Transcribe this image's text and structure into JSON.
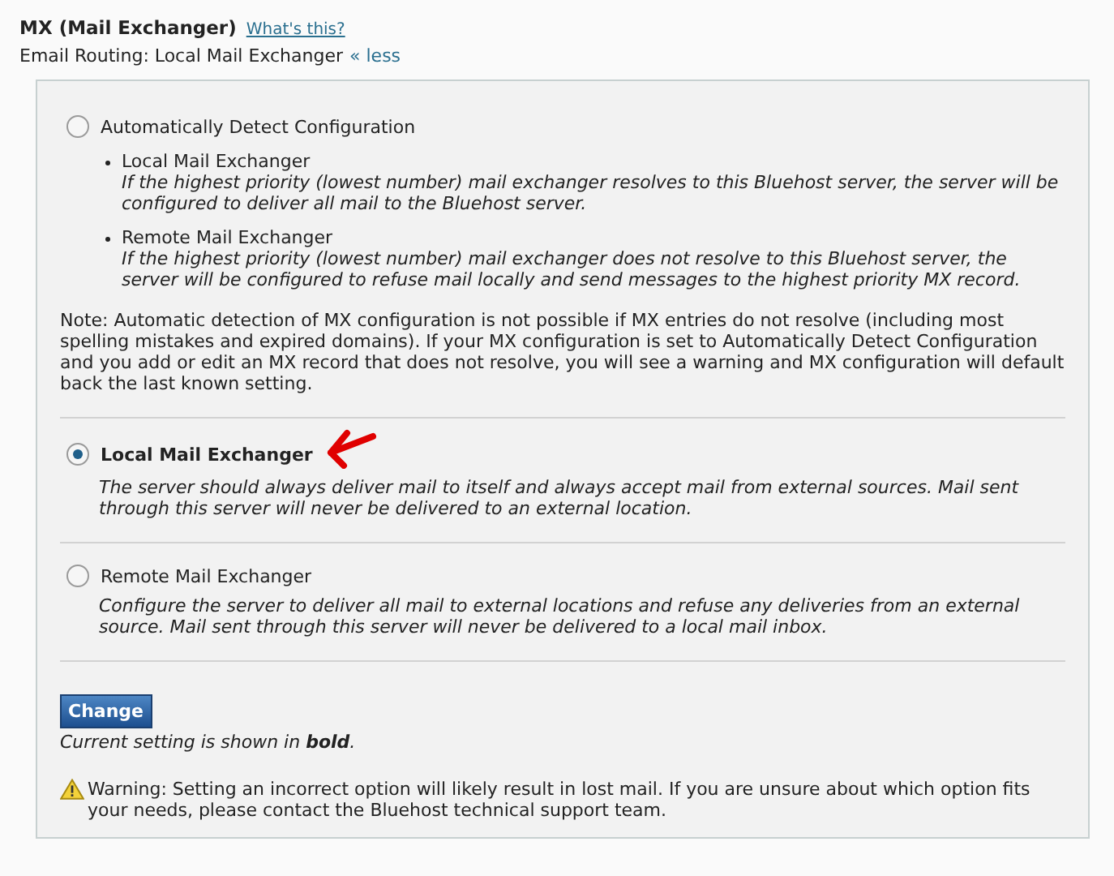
{
  "header": {
    "title": "MX (Mail Exchanger)",
    "help_link": "What's this?",
    "routing_label": "Email Routing: Local Mail Exchanger",
    "toggle_link": "« less"
  },
  "options": [
    {
      "label": "Automatically Detect Configuration",
      "selected": false,
      "current": false,
      "bullets": [
        {
          "title": "Local Mail Exchanger",
          "text": "If the highest priority (lowest number) mail exchanger resolves to this Bluehost server, the server will be configured to deliver all mail to the Bluehost server."
        },
        {
          "title": "Remote Mail Exchanger",
          "text": "If the highest priority (lowest number) mail exchanger does not resolve to this Bluehost server, the server will be configured to refuse mail locally and send messages to the highest priority MX record."
        }
      ],
      "note": "Note: Automatic detection of MX configuration is not possible if MX entries do not resolve (including most spelling mistakes and expired domains). If your MX configuration is set to Automatically Detect Configuration and you add or edit an MX record that does not resolve, you will see a warning and MX configuration will default back the last known setting."
    },
    {
      "label": "Local Mail Exchanger",
      "selected": true,
      "current": true,
      "annotated": true,
      "description": "The server should always deliver mail to itself and always accept mail from external sources. Mail sent through this server will never be delivered to an external location."
    },
    {
      "label": "Remote Mail Exchanger",
      "selected": false,
      "current": false,
      "description": "Configure the server to deliver all mail to external locations and refuse any deliveries from an external source. Mail sent through this server will never be delivered to a local mail inbox."
    }
  ],
  "button": "Change",
  "current_hint": "Current setting is shown in **bold**.",
  "warning": "Warning: Setting an incorrect option will likely result in lost mail. If you are unsure about which option fits your needs, please contact the Bluehost technical support team."
}
